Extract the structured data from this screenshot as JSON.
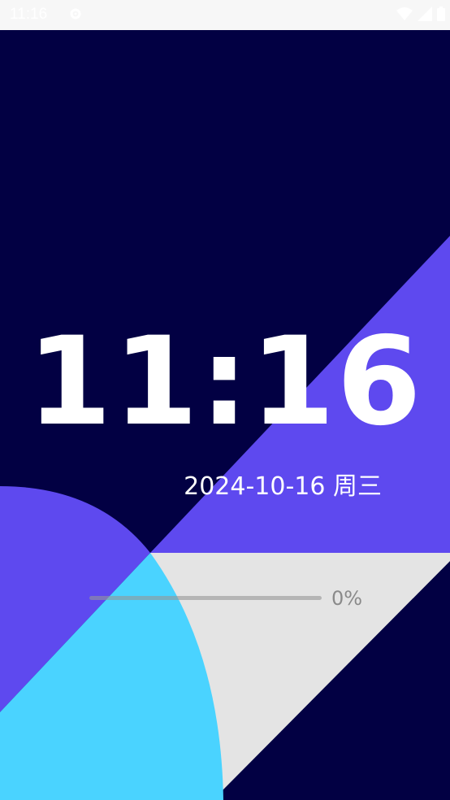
{
  "status_bar": {
    "time": "11:16",
    "icons": [
      "gear-icon",
      "wifi-icon",
      "signal-icon",
      "battery-icon"
    ]
  },
  "lockscreen": {
    "clock": "11:16",
    "date": "2024-10-16 周三"
  },
  "progress": {
    "percent_label": "0%",
    "value": 0
  },
  "colors": {
    "background": "#020043",
    "purple": "#5e49ef",
    "cyan": "#4ad3ff",
    "light_gray": "#e4e4e4",
    "status_bar": "#f7f7f7"
  }
}
